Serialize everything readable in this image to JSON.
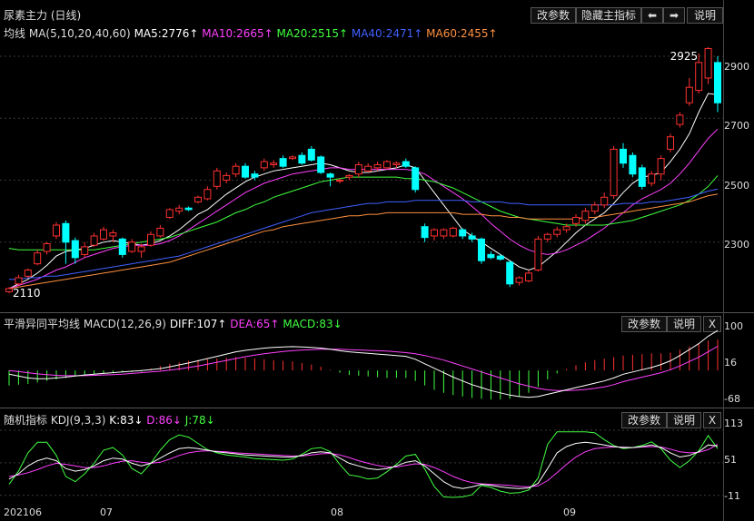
{
  "header": {
    "title": "尿素主力 (日线)",
    "buttons": [
      "改参数",
      "隐藏主指标",
      "⬅",
      "➡",
      "说明"
    ]
  },
  "main": {
    "indicator_name": "均线",
    "params": "MA(5,10,20,40,60)",
    "legend": [
      {
        "label": "MA5:2776↑",
        "color": "#ffffff"
      },
      {
        "label": "MA10:2665↑",
        "color": "#ff40ff"
      },
      {
        "label": "MA20:2515↑",
        "color": "#40ff40"
      },
      {
        "label": "MA40:2471↑",
        "color": "#4060ff"
      },
      {
        "label": "MA60:2455↑",
        "color": "#ff9040"
      }
    ],
    "yticks": [
      "2900",
      "2700",
      "2500",
      "2300"
    ],
    "annotations": {
      "high": "2925",
      "low": "2110"
    }
  },
  "macd": {
    "title": "平滑异同平均线",
    "params": "MACD(12,26,9)",
    "diff": "DIFF:107↑",
    "dea": "DEA:65↑",
    "macd": "MACD:83↓",
    "buttons": [
      "改参数",
      "说明",
      "X"
    ],
    "yticks": [
      "100",
      "16",
      "-68"
    ]
  },
  "kdj": {
    "title": "随机指标",
    "params": "KDJ(9,3,3)",
    "k": "K:83↓",
    "d": "D:86↓",
    "j": "J:78↓",
    "buttons": [
      "改参数",
      "说明",
      "X"
    ],
    "yticks": [
      "113",
      "51",
      "-11"
    ]
  },
  "xaxis": {
    "labels": [
      "202106",
      "07",
      "08",
      "09"
    ]
  },
  "colors": {
    "up": "#ff3030",
    "down": "#00ffff",
    "macd_pos": "#ff3030",
    "macd_neg": "#40ff40"
  },
  "chart_data": {
    "type": "candlestick",
    "ylim": [
      2100,
      2950
    ],
    "candles": [
      [
        2140,
        2150,
        2135,
        2155
      ],
      [
        2165,
        2185,
        2160,
        2195
      ],
      [
        2190,
        2210,
        2185,
        2215
      ],
      [
        2230,
        2265,
        2225,
        2275
      ],
      [
        2270,
        2295,
        2260,
        2300
      ],
      [
        2320,
        2355,
        2310,
        2365
      ],
      [
        2360,
        2300,
        2230,
        2370
      ],
      [
        2305,
        2250,
        2230,
        2315
      ],
      [
        2260,
        2285,
        2250,
        2300
      ],
      [
        2290,
        2320,
        2285,
        2330
      ],
      [
        2310,
        2340,
        2305,
        2350
      ],
      [
        2320,
        2330,
        2300,
        2340
      ],
      [
        2310,
        2260,
        2250,
        2315
      ],
      [
        2270,
        2300,
        2265,
        2310
      ],
      [
        2270,
        2285,
        2250,
        2295
      ],
      [
        2290,
        2325,
        2285,
        2335
      ],
      [
        2320,
        2345,
        2315,
        2355
      ],
      [
        2380,
        2405,
        2375,
        2410
      ],
      [
        2400,
        2410,
        2390,
        2420
      ],
      [
        2410,
        2405,
        2400,
        2415
      ],
      [
        2430,
        2445,
        2425,
        2450
      ],
      [
        2440,
        2470,
        2435,
        2480
      ],
      [
        2480,
        2530,
        2470,
        2540
      ],
      [
        2500,
        2515,
        2490,
        2525
      ],
      [
        2520,
        2545,
        2510,
        2555
      ],
      [
        2545,
        2510,
        2505,
        2555
      ],
      [
        2520,
        2510,
        2500,
        2530
      ],
      [
        2540,
        2560,
        2530,
        2570
      ],
      [
        2550,
        2555,
        2540,
        2565
      ],
      [
        2570,
        2545,
        2540,
        2580
      ],
      [
        2570,
        2575,
        2565,
        2580
      ],
      [
        2580,
        2555,
        2550,
        2590
      ],
      [
        2600,
        2565,
        2560,
        2610
      ],
      [
        2575,
        2525,
        2520,
        2580
      ],
      [
        2520,
        2510,
        2480,
        2525
      ],
      [
        2500,
        2500,
        2490,
        2505
      ],
      [
        2510,
        2515,
        2500,
        2520
      ],
      [
        2520,
        2550,
        2510,
        2560
      ],
      [
        2530,
        2545,
        2525,
        2555
      ],
      [
        2540,
        2550,
        2530,
        2560
      ],
      [
        2540,
        2560,
        2535,
        2565
      ],
      [
        2550,
        2555,
        2540,
        2560
      ],
      [
        2560,
        2545,
        2540,
        2570
      ],
      [
        2540,
        2470,
        2460,
        2545
      ],
      [
        2350,
        2315,
        2300,
        2360
      ],
      [
        2320,
        2340,
        2305,
        2345
      ],
      [
        2320,
        2340,
        2310,
        2345
      ],
      [
        2320,
        2345,
        2315,
        2350
      ],
      [
        2340,
        2320,
        2310,
        2345
      ],
      [
        2320,
        2310,
        2300,
        2330
      ],
      [
        2310,
        2240,
        2230,
        2315
      ],
      [
        2260,
        2250,
        2245,
        2270
      ],
      [
        2255,
        2245,
        2240,
        2260
      ],
      [
        2235,
        2165,
        2155,
        2240
      ],
      [
        2170,
        2185,
        2160,
        2190
      ],
      [
        2175,
        2200,
        2170,
        2210
      ],
      [
        2210,
        2310,
        2205,
        2320
      ],
      [
        2310,
        2325,
        2300,
        2330
      ],
      [
        2325,
        2340,
        2315,
        2350
      ],
      [
        2340,
        2350,
        2330,
        2360
      ],
      [
        2360,
        2380,
        2350,
        2390
      ],
      [
        2370,
        2400,
        2360,
        2410
      ],
      [
        2400,
        2420,
        2390,
        2430
      ],
      [
        2420,
        2445,
        2410,
        2460
      ],
      [
        2450,
        2600,
        2440,
        2610
      ],
      [
        2600,
        2555,
        2540,
        2620
      ],
      [
        2580,
        2520,
        2510,
        2590
      ],
      [
        2540,
        2480,
        2470,
        2550
      ],
      [
        2490,
        2520,
        2480,
        2530
      ],
      [
        2520,
        2570,
        2500,
        2580
      ],
      [
        2600,
        2640,
        2590,
        2650
      ],
      [
        2680,
        2710,
        2670,
        2720
      ],
      [
        2750,
        2800,
        2740,
        2830
      ],
      [
        2790,
        2880,
        2780,
        2910
      ],
      [
        2830,
        2925,
        2810,
        2930
      ],
      [
        2880,
        2750,
        2720,
        2900
      ]
    ],
    "ma": {
      "MA5": [
        2150,
        2165,
        2180,
        2200,
        2225,
        2255,
        2270,
        2275,
        2280,
        2290,
        2300,
        2305,
        2300,
        2295,
        2290,
        2295,
        2305,
        2320,
        2340,
        2365,
        2390,
        2405,
        2430,
        2455,
        2475,
        2495,
        2510,
        2520,
        2530,
        2535,
        2540,
        2545,
        2550,
        2555,
        2550,
        2540,
        2530,
        2525,
        2525,
        2530,
        2535,
        2540,
        2550,
        2540,
        2500,
        2460,
        2420,
        2380,
        2340,
        2320,
        2300,
        2280,
        2260,
        2240,
        2220,
        2210,
        2220,
        2245,
        2270,
        2300,
        2330,
        2355,
        2375,
        2395,
        2425,
        2460,
        2490,
        2510,
        2515,
        2525,
        2560,
        2600,
        2650,
        2720,
        2780,
        2776
      ],
      "MA10": [
        2150,
        2160,
        2170,
        2180,
        2195,
        2210,
        2220,
        2235,
        2250,
        2260,
        2270,
        2280,
        2285,
        2290,
        2290,
        2290,
        2295,
        2305,
        2320,
        2340,
        2360,
        2380,
        2400,
        2420,
        2440,
        2460,
        2475,
        2490,
        2500,
        2510,
        2520,
        2525,
        2530,
        2535,
        2540,
        2540,
        2535,
        2535,
        2535,
        2535,
        2535,
        2535,
        2535,
        2530,
        2520,
        2500,
        2480,
        2460,
        2440,
        2415,
        2390,
        2360,
        2335,
        2310,
        2290,
        2275,
        2265,
        2260,
        2265,
        2275,
        2290,
        2305,
        2325,
        2345,
        2370,
        2395,
        2420,
        2440,
        2455,
        2470,
        2490,
        2520,
        2555,
        2595,
        2635,
        2665
      ],
      "MA20": [
        2280,
        2275,
        2275,
        2275,
        2275,
        2275,
        2275,
        2275,
        2275,
        2275,
        2280,
        2285,
        2290,
        2295,
        2300,
        2305,
        2310,
        2315,
        2325,
        2335,
        2345,
        2355,
        2365,
        2380,
        2395,
        2405,
        2420,
        2430,
        2445,
        2455,
        2465,
        2475,
        2485,
        2495,
        2500,
        2505,
        2510,
        2510,
        2510,
        2510,
        2510,
        2510,
        2505,
        2505,
        2500,
        2495,
        2485,
        2475,
        2460,
        2445,
        2430,
        2415,
        2400,
        2390,
        2380,
        2375,
        2370,
        2365,
        2360,
        2355,
        2355,
        2355,
        2355,
        2355,
        2360,
        2365,
        2370,
        2380,
        2390,
        2400,
        2410,
        2420,
        2435,
        2455,
        2480,
        2515
      ],
      "MA40": [
        2180,
        2180,
        2185,
        2185,
        2190,
        2190,
        2195,
        2200,
        2205,
        2210,
        2215,
        2220,
        2225,
        2230,
        2235,
        2240,
        2245,
        2250,
        2255,
        2265,
        2275,
        2285,
        2295,
        2305,
        2315,
        2325,
        2335,
        2345,
        2355,
        2365,
        2375,
        2385,
        2395,
        2400,
        2405,
        2410,
        2415,
        2420,
        2425,
        2425,
        2430,
        2430,
        2430,
        2435,
        2435,
        2435,
        2435,
        2435,
        2435,
        2430,
        2430,
        2430,
        2430,
        2425,
        2425,
        2420,
        2420,
        2420,
        2420,
        2420,
        2420,
        2420,
        2420,
        2420,
        2420,
        2425,
        2425,
        2425,
        2430,
        2430,
        2435,
        2440,
        2445,
        2455,
        2465,
        2471
      ],
      "MA60": [
        2150,
        2155,
        2160,
        2165,
        2170,
        2175,
        2180,
        2185,
        2190,
        2195,
        2200,
        2205,
        2210,
        2215,
        2220,
        2225,
        2230,
        2235,
        2245,
        2255,
        2265,
        2275,
        2285,
        2295,
        2305,
        2315,
        2325,
        2335,
        2340,
        2350,
        2355,
        2360,
        2365,
        2370,
        2375,
        2380,
        2385,
        2385,
        2390,
        2390,
        2395,
        2395,
        2395,
        2395,
        2395,
        2395,
        2395,
        2395,
        2390,
        2390,
        2390,
        2385,
        2385,
        2380,
        2380,
        2375,
        2375,
        2375,
        2375,
        2375,
        2375,
        2380,
        2380,
        2385,
        2390,
        2395,
        2400,
        2405,
        2410,
        2415,
        2420,
        2425,
        2430,
        2440,
        2450,
        2455
      ]
    },
    "macd": {
      "ylim": [
        -80,
        110
      ],
      "dif": [
        -10,
        -15,
        -20,
        -22,
        -22,
        -20,
        -18,
        -15,
        -12,
        -10,
        -8,
        -6,
        -4,
        -2,
        0,
        2,
        5,
        10,
        15,
        20,
        26,
        32,
        38,
        44,
        50,
        54,
        57,
        60,
        62,
        63,
        64,
        63,
        62,
        60,
        57,
        53,
        50,
        48,
        46,
        44,
        42,
        40,
        38,
        30,
        18,
        6,
        -6,
        -18,
        -28,
        -38,
        -46,
        -54,
        -60,
        -66,
        -70,
        -72,
        -70,
        -64,
        -58,
        -52,
        -46,
        -40,
        -34,
        -28,
        -20,
        -10,
        -4,
        2,
        8,
        16,
        26,
        40,
        56,
        72,
        92,
        107
      ],
      "dea": [
        0,
        -3,
        -6,
        -9,
        -11,
        -13,
        -14,
        -14,
        -14,
        -13,
        -12,
        -11,
        -10,
        -8,
        -6,
        -4,
        -2,
        1,
        4,
        8,
        12,
        17,
        22,
        27,
        32,
        37,
        41,
        45,
        48,
        51,
        53,
        55,
        56,
        57,
        57,
        57,
        56,
        55,
        54,
        53,
        52,
        50,
        48,
        45,
        40,
        34,
        28,
        20,
        12,
        4,
        -4,
        -12,
        -20,
        -28,
        -36,
        -42,
        -48,
        -52,
        -54,
        -54,
        -53,
        -51,
        -48,
        -44,
        -38,
        -30,
        -24,
        -18,
        -12,
        -6,
        2,
        12,
        24,
        36,
        50,
        65
      ],
      "hist": [
        -40,
        -38,
        -36,
        -32,
        -28,
        -24,
        -20,
        -16,
        -12,
        -10,
        -8,
        -6,
        -5,
        -4,
        -3,
        6,
        12,
        18,
        22,
        26,
        28,
        30,
        32,
        34,
        36,
        34,
        32,
        30,
        28,
        26,
        24,
        20,
        16,
        10,
        2,
        -6,
        -12,
        -14,
        -16,
        -18,
        -20,
        -20,
        -20,
        -28,
        -40,
        -52,
        -60,
        -66,
        -70,
        -74,
        -76,
        -78,
        -78,
        -76,
        -70,
        -60,
        -44,
        -24,
        -8,
        4,
        14,
        22,
        28,
        32,
        36,
        40,
        42,
        44,
        46,
        46,
        48,
        56,
        64,
        72,
        80,
        83
      ]
    },
    "kdj": {
      "ylim": [
        -15,
        120
      ],
      "k": [
        20,
        30,
        45,
        55,
        60,
        55,
        40,
        35,
        38,
        45,
        55,
        60,
        58,
        50,
        45,
        50,
        60,
        70,
        78,
        80,
        78,
        75,
        72,
        70,
        68,
        66,
        65,
        64,
        63,
        62,
        62,
        65,
        70,
        72,
        70,
        60,
        50,
        45,
        40,
        38,
        40,
        45,
        52,
        55,
        45,
        30,
        15,
        5,
        2,
        5,
        10,
        8,
        5,
        3,
        2,
        3,
        12,
        40,
        70,
        82,
        88,
        90,
        88,
        85,
        82,
        80,
        80,
        82,
        85,
        80,
        70,
        62,
        65,
        72,
        85,
        83
      ],
      "d": [
        25,
        28,
        32,
        38,
        45,
        50,
        48,
        45,
        42,
        42,
        45,
        50,
        54,
        55,
        52,
        50,
        52,
        58,
        65,
        70,
        73,
        74,
        73,
        72,
        70,
        69,
        68,
        67,
        66,
        65,
        64,
        64,
        66,
        68,
        69,
        66,
        61,
        55,
        50,
        46,
        43,
        43,
        46,
        49,
        48,
        42,
        34,
        25,
        18,
        13,
        11,
        10,
        9,
        8,
        6,
        5,
        7,
        17,
        32,
        48,
        62,
        72,
        78,
        80,
        81,
        81,
        80,
        81,
        82,
        81,
        77,
        72,
        70,
        71,
        76,
        86
      ],
      "j": [
        10,
        35,
        70,
        90,
        90,
        65,
        25,
        15,
        30,
        50,
        75,
        80,
        66,
        40,
        30,
        50,
        75,
        95,
        104,
        100,
        88,
        76,
        70,
        66,
        64,
        62,
        59,
        58,
        57,
        56,
        58,
        67,
        78,
        80,
        72,
        48,
        28,
        25,
        20,
        22,
        34,
        48,
        64,
        67,
        39,
        6,
        -14,
        -15,
        -14,
        -10,
        8,
        4,
        -3,
        -7,
        -6,
        -1,
        22,
        86,
        110,
        110,
        110,
        110,
        108,
        95,
        84,
        78,
        80,
        84,
        91,
        78,
        56,
        42,
        55,
        74,
        103,
        78
      ]
    }
  }
}
